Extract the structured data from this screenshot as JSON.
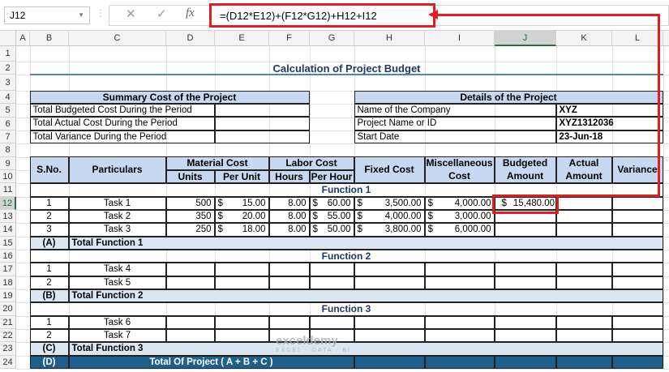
{
  "formula_bar": {
    "name_box": "J12",
    "cancel_icon": "✕",
    "enter_icon": "✓",
    "fx_label": "fx",
    "formula": "=(D12*E12)+(F12*G12)+H12+I12"
  },
  "columns": [
    "A",
    "B",
    "C",
    "D",
    "E",
    "F",
    "G",
    "H",
    "I",
    "J",
    "K",
    "L"
  ],
  "rows": [
    "1",
    "2",
    "3",
    "4",
    "5",
    "6",
    "7",
    "8",
    "9",
    "10",
    "11",
    "12",
    "13",
    "14",
    "15",
    "16",
    "17",
    "18",
    "19",
    "20",
    "21",
    "22",
    "23",
    "24"
  ],
  "selected_cell": "J12",
  "colors": {
    "accent_red": "#e31b23",
    "header_fill": "#c6d9f0",
    "total_fill": "#dce6f1",
    "grand_total_fill": "#1f5f8b",
    "title_text": "#1f3864"
  },
  "cells": {
    "B2": "Calculation of Project Budget",
    "B4": "Summary Cost of the Project",
    "B5": "Total Budgeted Cost During the Period",
    "B6": "Total Actual Cost During the Period",
    "B7": "Total Variance During the Period",
    "H4": "Details of the Project",
    "H5": "Name of the Company",
    "K5": "XYZ",
    "H6": "Project Name or ID",
    "K6": "XYZ1312036",
    "H7": "Start Date",
    "K7": "23-Jun-18",
    "B9": "S.No.",
    "C9": "Particulars",
    "D9": "Material Cost",
    "F9": "Labor Cost",
    "H9": "Fixed Cost",
    "I9": "Miscellaneous Cost",
    "J9": "Budgeted Amount",
    "K9": "Actual Amount",
    "L9": "Variance",
    "D10": "Units",
    "E10": "Per Unit",
    "F10": "Hours",
    "G10": "Per Hour",
    "B11": "Function 1",
    "B12": "1",
    "C12": "Task 1",
    "D12": "500",
    "E12": "15.00",
    "F12": "8.00",
    "G12": "60.00",
    "H12": "3,500.00",
    "I12": "4,000.00",
    "J12": "15,480.00",
    "B13": "2",
    "C13": "Task 2",
    "D13": "350",
    "E13": "20.00",
    "F13": "8.00",
    "G13": "55.00",
    "H13": "4,000.00",
    "I13": "3,000.00",
    "B14": "3",
    "C14": "Task 3",
    "D14": "250",
    "E14": "18.00",
    "F14": "8.00",
    "G14": "50.00",
    "H14": "3,800.00",
    "I14": "6,000.00",
    "B15": "(A)",
    "C15": "Total Function 1",
    "B16": "Function 2",
    "B17": "1",
    "C17": "Task 4",
    "B18": "2",
    "C18": "Task 5",
    "B19": "(B)",
    "C19": "Total Function 2",
    "B20": "Function 3",
    "B21": "1",
    "C21": "Task 6",
    "B22": "2",
    "C22": "Task 7",
    "B23": "(C)",
    "C23": "Total Function 3",
    "B24": "(D)",
    "C24": "Total Of Project ( A + B + C )"
  },
  "currency_symbol": "$",
  "watermark": {
    "name": "exceldemy",
    "tagline": "EXCEL · DATA · BI"
  }
}
